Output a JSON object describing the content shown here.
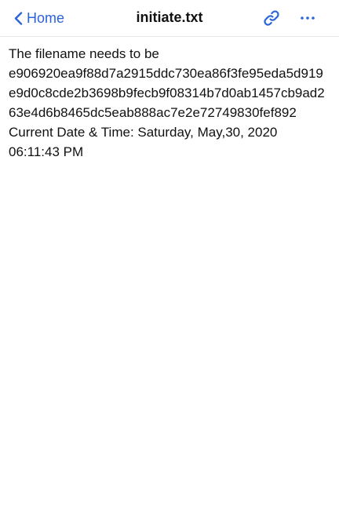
{
  "navbar": {
    "back_label": "Home",
    "title": "initiate.txt",
    "accent_color": "#2b63d9",
    "icons": [
      "chevron-left-icon",
      "link-icon",
      "more-icon"
    ]
  },
  "document": {
    "line1": "The filename needs to be",
    "hash": "e906920ea9f88d7a2915ddc730ea86f3fe95eda5d919e9d0c8cde2b3698b9fecb9f08314b7d0ab1457cb9ad263e4d6b8465dc5eab888ac7e2e72749830fef892",
    "datetime_line": "Current Date & Time: Saturday, May,30, 2020",
    "time_line": "06:11:43 PM"
  }
}
